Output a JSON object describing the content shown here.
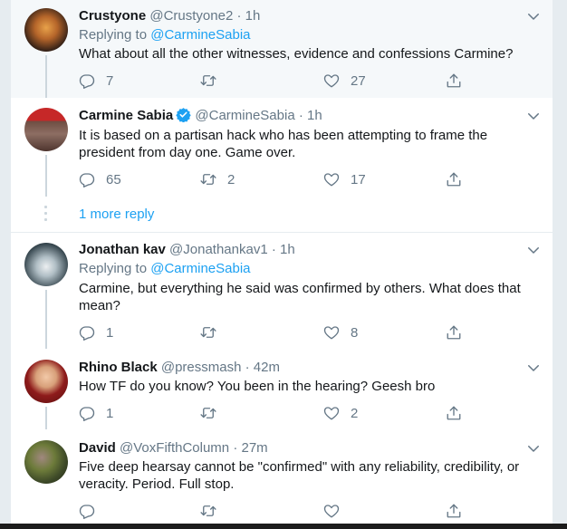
{
  "tweets": [
    {
      "name": "Crustyone",
      "handle": "@Crustyone2",
      "time": "1h",
      "replying_label": "Replying to",
      "replying_to": "@CarmineSabia",
      "text": "What about all the other witnesses, evidence and confessions Carmine?",
      "replies": "7",
      "retweets": "",
      "likes": "27"
    },
    {
      "name": "Carmine Sabia",
      "handle": "@CarmineSabia",
      "time": "1h",
      "verified": true,
      "text_line1": "It is based on a partisan hack who has been attempting to frame the",
      "text_line2": "president from day one. Game over.",
      "replies": "65",
      "retweets": "2",
      "likes": "17"
    },
    {
      "name": "Jonathan kav",
      "handle": "@Jonathankav1",
      "time": "1h",
      "replying_label": "Replying to",
      "replying_to": "@CarmineSabia",
      "text_line1": "Carmine, but everything he said was confirmed by others. What does that",
      "text_line2": "mean?",
      "replies": "1",
      "retweets": "",
      "likes": "8"
    },
    {
      "name": "Rhino Black",
      "handle": "@pressmash",
      "time": "42m",
      "text": "How TF do you know? You been in the hearing? Geesh bro",
      "replies": "1",
      "retweets": "",
      "likes": "2"
    },
    {
      "name": "David",
      "handle": "@VoxFifthColumn",
      "time": "27m",
      "text_line1": "Five deep hearsay cannot be \"confirmed\" with any reliability, credibility, or",
      "text_line2": "veracity. Period. Full stop.",
      "replies": "",
      "retweets": "",
      "likes": ""
    }
  ],
  "more_reply_label": "1 more reply",
  "dot_separator": "·",
  "colors": {
    "accent": "#1da1f2",
    "secondary_text": "#657786",
    "thread_line": "#ccd6dd",
    "highlight_bg": "#f5f8fa"
  },
  "icons": [
    "reply-icon",
    "retweet-icon",
    "like-icon",
    "share-icon",
    "chevron-down-icon",
    "verified-badge-icon"
  ]
}
